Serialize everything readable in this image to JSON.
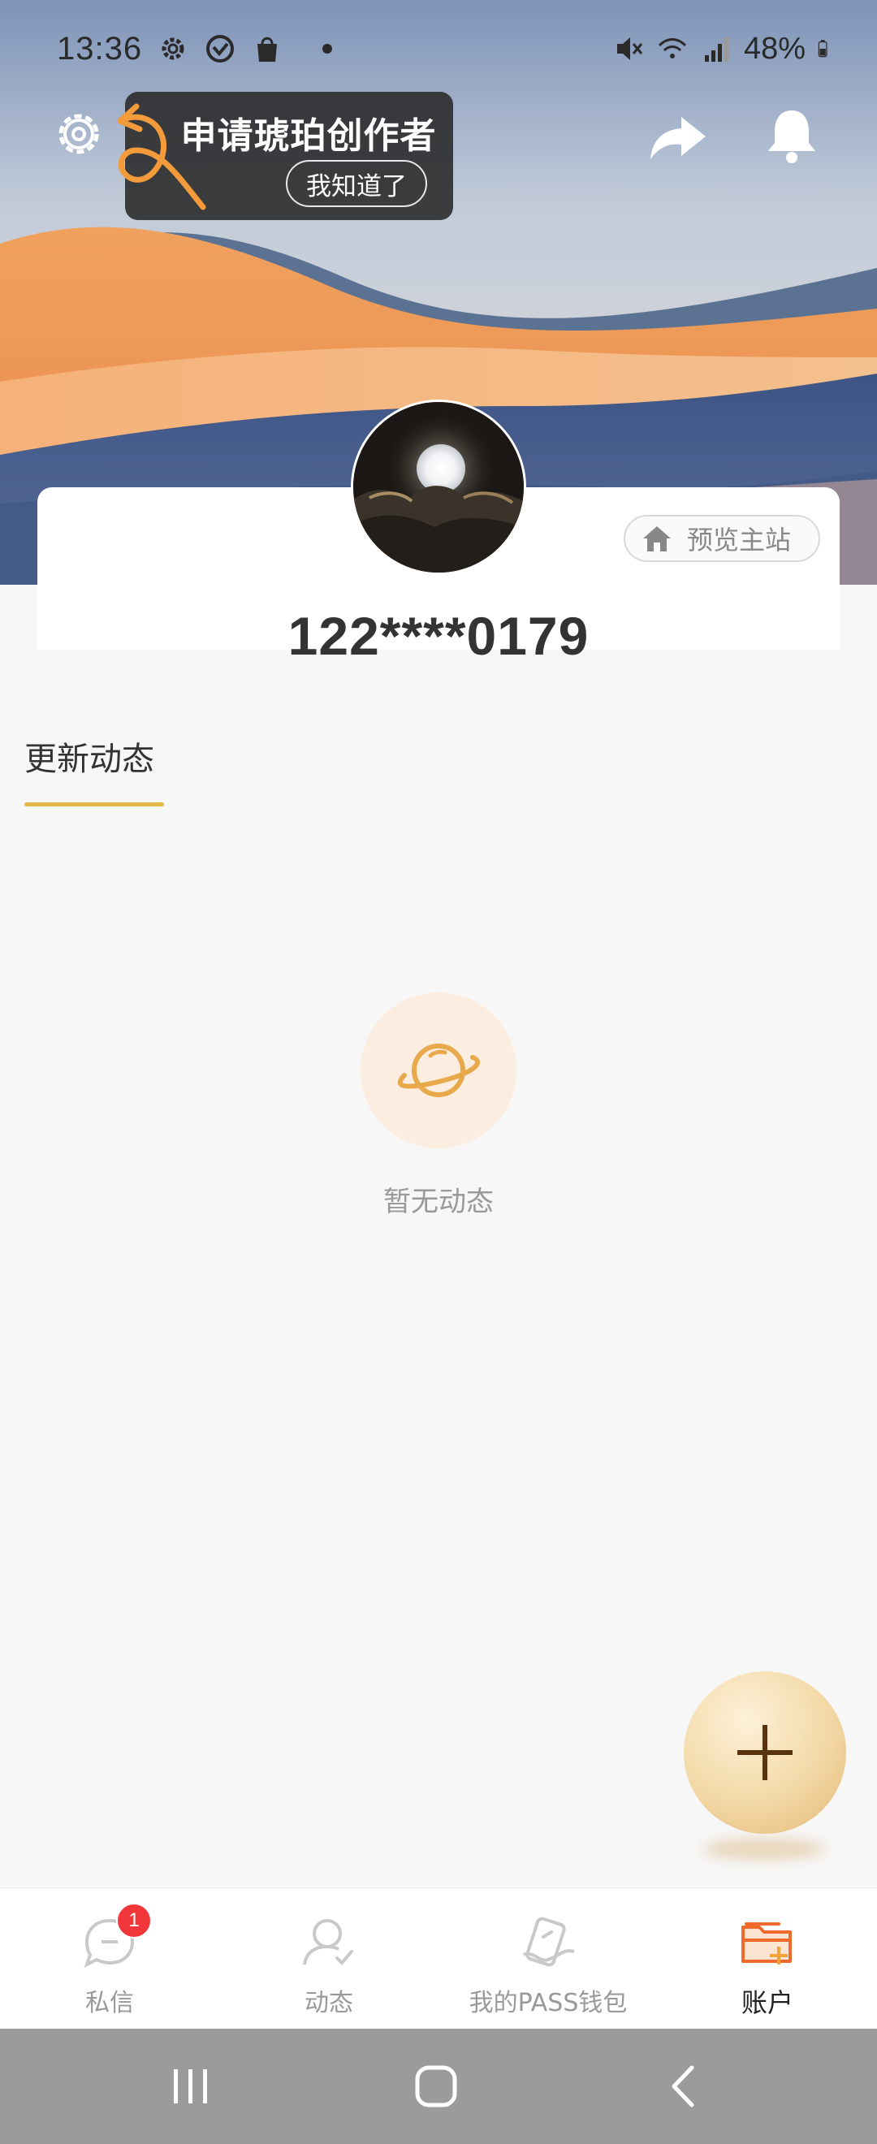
{
  "status_bar": {
    "time": "13:36",
    "battery_percent": "48%",
    "left_icons": [
      "settings-icon",
      "heart-check-icon",
      "shopping-bag-icon",
      "notification-dot"
    ],
    "right_icons": [
      "mute-icon",
      "wifi-icon",
      "signal-icon",
      "battery-icon"
    ]
  },
  "top_actions": {
    "icons": [
      "settings-icon",
      "share-icon",
      "bell-icon"
    ]
  },
  "tooltip": {
    "title": "申请琥珀创作者",
    "button": "我知道了"
  },
  "profile": {
    "username": "122****0179",
    "preview_button": "预览主站"
  },
  "section": {
    "tab_label": "更新动态"
  },
  "empty_state": {
    "text": "暂无动态",
    "icon": "planet-icon"
  },
  "bottom_nav": {
    "items": [
      {
        "label": "私信",
        "icon": "message-icon",
        "badge": "1"
      },
      {
        "label": "动态",
        "icon": "user-check-icon"
      },
      {
        "label": "我的PASS钱包",
        "icon": "wallet-card-icon"
      },
      {
        "label": "账户",
        "icon": "folder-plus-icon",
        "active": true
      }
    ]
  },
  "colors": {
    "accent_gold": "#e6b84a",
    "active_orange": "#f06a2b",
    "badge_red": "#f2373a"
  }
}
